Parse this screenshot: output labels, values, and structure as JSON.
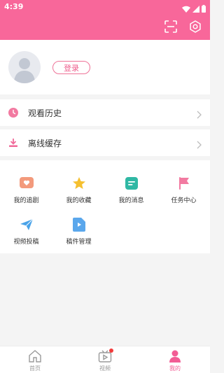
{
  "status_bar": {
    "time": "4:39"
  },
  "colors": {
    "accent": "#f8679a",
    "active_tab": "#f25d95",
    "history_icon": "#f27aa1",
    "download_icon": "#f06a99"
  },
  "header": {
    "scan_icon": "scan-icon",
    "settings_icon": "settings-icon"
  },
  "profile": {
    "login_label": "登录",
    "avatar_icon": "default-avatar"
  },
  "menu": [
    {
      "label": "观看历史",
      "icon": "clock-icon"
    },
    {
      "label": "离线缓存",
      "icon": "download-icon"
    }
  ],
  "grid": [
    {
      "label": "我的追剧",
      "icon": "heart-tv-icon",
      "color": "#f39a7c"
    },
    {
      "label": "我的收藏",
      "icon": "star-icon",
      "color": "#f5c030"
    },
    {
      "label": "我的消息",
      "icon": "message-icon",
      "color": "#2fb8a4"
    },
    {
      "label": "任务中心",
      "icon": "flag-icon",
      "color": "#f27aa1"
    },
    {
      "label": "视频投稿",
      "icon": "paper-plane-icon",
      "color": "#4aa3e8"
    },
    {
      "label": "稿件管理",
      "icon": "document-icon",
      "color": "#5aa7ec"
    }
  ],
  "bottom_nav": [
    {
      "label": "首页",
      "icon": "home-icon",
      "active": false
    },
    {
      "label": "视频",
      "icon": "tv-play-icon",
      "active": false,
      "badge": true
    },
    {
      "label": "我的",
      "icon": "person-icon",
      "active": true
    }
  ]
}
